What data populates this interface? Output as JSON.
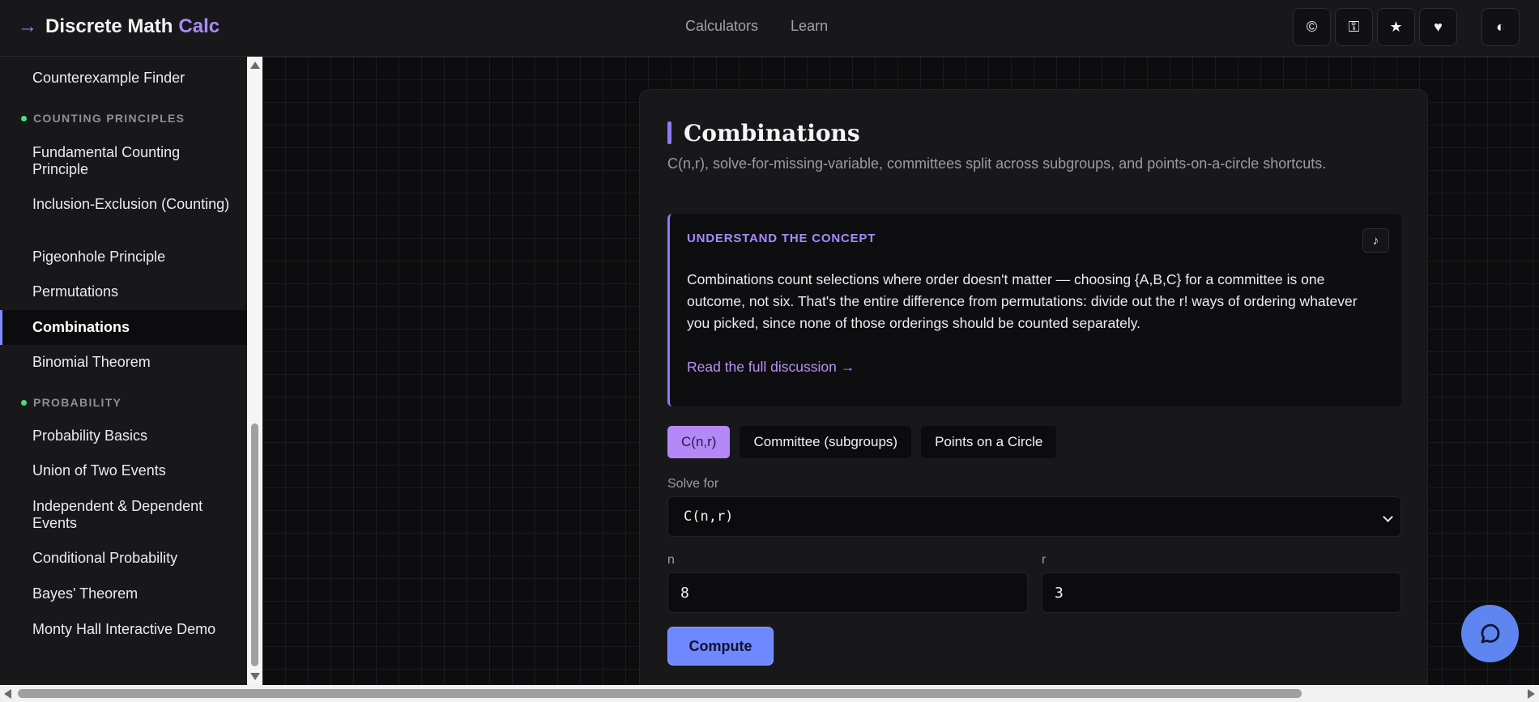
{
  "header": {
    "arrow_glyph": "→",
    "brand_name": "Discrete Math",
    "brand_accent": "Calc",
    "nav": [
      {
        "label": "Calculators"
      },
      {
        "label": "Learn"
      }
    ],
    "icons": [
      {
        "name": "copyright-icon",
        "glyph": "©"
      },
      {
        "name": "key-icon",
        "glyph": "⚿"
      },
      {
        "name": "star-icon",
        "glyph": "★"
      },
      {
        "name": "heart-icon",
        "glyph": "♥"
      },
      {
        "name": "theme-toggle-icon",
        "glyph": "◐"
      }
    ]
  },
  "sidebar": {
    "items": [
      {
        "type": "item",
        "label": "Counterexample Finder"
      },
      {
        "type": "section",
        "label": "COUNTING PRINCIPLES"
      },
      {
        "type": "item",
        "label": "Fundamental Counting Principle"
      },
      {
        "type": "item",
        "label": "Inclusion-Exclusion (Counting)"
      },
      {
        "type": "item",
        "label": "Pigeonhole Principle"
      },
      {
        "type": "item",
        "label": "Permutations"
      },
      {
        "type": "item",
        "label": "Combinations",
        "active": true
      },
      {
        "type": "item",
        "label": "Binomial Theorem"
      },
      {
        "type": "section",
        "label": "PROBABILITY"
      },
      {
        "type": "item",
        "label": "Probability Basics"
      },
      {
        "type": "item",
        "label": "Union of Two Events"
      },
      {
        "type": "item",
        "label": "Independent & Dependent Events"
      },
      {
        "type": "item",
        "label": "Conditional Probability"
      },
      {
        "type": "item",
        "label": "Bayes' Theorem"
      },
      {
        "type": "item",
        "label": "Monty Hall Interactive Demo"
      }
    ]
  },
  "card": {
    "title": "Combinations",
    "subtitle": "C(n,r), solve-for-missing-variable, committees split across subgroups, and points-on-a-circle shortcuts.",
    "concept": {
      "label": "UNDERSTAND THE CONCEPT",
      "audio_glyph": "♪",
      "text": "Combinations count selections where order doesn't matter — choosing {A,B,C} for a committee is one outcome, not six. That's the entire difference from permutations: divide out the r! ways of ordering whatever you picked, since none of those orderings should be counted separately.",
      "link": "Read the full discussion →"
    },
    "tabs": [
      {
        "label": "C(n,r)",
        "active": true
      },
      {
        "label": "Committee (subgroups)"
      },
      {
        "label": "Points on a Circle"
      }
    ],
    "solve_for_label": "Solve for",
    "solve_for_value": "C(n,r)",
    "n_label": "n",
    "n_value": "8",
    "r_label": "r",
    "r_value": "3",
    "compute_label": "Compute"
  },
  "colors": {
    "accent_purple": "#a78bfa",
    "accent_blue": "#6f87ff",
    "section_dot": "#4ade80",
    "background": "#0d0d0f"
  }
}
